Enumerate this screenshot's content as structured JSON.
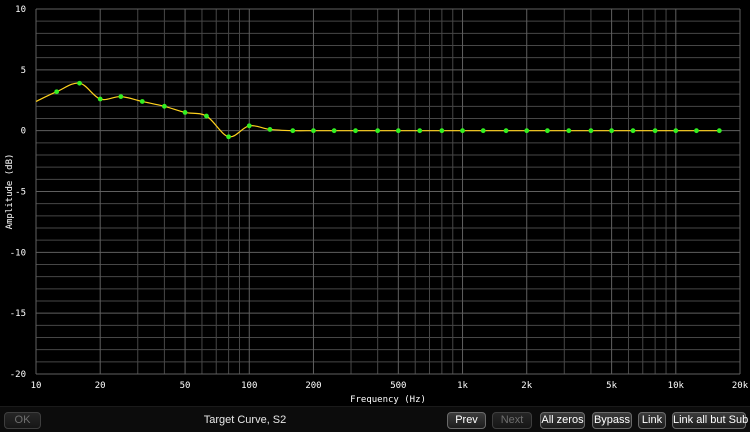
{
  "chart_data": {
    "type": "line",
    "xlabel": "Frequency (Hz)",
    "ylabel": "Amplitude (dB)",
    "xscale": "log",
    "xlim": [
      10,
      20000
    ],
    "ylim": [
      -20,
      10
    ],
    "grid": true,
    "x_ticks": [
      {
        "value": 10,
        "label": "10"
      },
      {
        "value": 20,
        "label": "20"
      },
      {
        "value": 50,
        "label": "50"
      },
      {
        "value": 100,
        "label": "100"
      },
      {
        "value": 200,
        "label": "200"
      },
      {
        "value": 500,
        "label": "500"
      },
      {
        "value": 1000,
        "label": "1k"
      },
      {
        "value": 2000,
        "label": "2k"
      },
      {
        "value": 5000,
        "label": "5k"
      },
      {
        "value": 10000,
        "label": "10k"
      },
      {
        "value": 20000,
        "label": "20k"
      }
    ],
    "y_ticks": [
      {
        "value": 10,
        "label": "10"
      },
      {
        "value": 5,
        "label": "5"
      },
      {
        "value": 0,
        "label": "0"
      },
      {
        "value": -5,
        "label": "-5"
      },
      {
        "value": -10,
        "label": "-10"
      },
      {
        "value": -15,
        "label": "-15"
      },
      {
        "value": -20,
        "label": "-20"
      }
    ],
    "series": [
      {
        "x": [
          12.5,
          16,
          20,
          25,
          31.5,
          40,
          50,
          63,
          80,
          100,
          125,
          160,
          200,
          250,
          315,
          400,
          500,
          630,
          800,
          1000,
          1250,
          1600,
          2000,
          2500,
          3150,
          4000,
          5000,
          6300,
          8000,
          10000,
          12500,
          16000
        ],
        "y": [
          3.2,
          3.9,
          2.6,
          2.8,
          2.4,
          2.0,
          1.5,
          1.2,
          -0.5,
          0.4,
          0.1,
          0,
          0,
          0,
          0,
          0,
          0,
          0,
          0,
          0,
          0,
          0,
          0,
          0,
          0,
          0,
          0,
          0,
          0,
          0,
          0,
          0
        ]
      }
    ],
    "curve_start": {
      "x": 10,
      "y": 2.4
    },
    "colors": {
      "background": "#000000",
      "grid": "#5f5f5f",
      "grid_minor": "#474747",
      "line": "#ffd21e",
      "point": "#33ee22",
      "text": "#ffffff"
    }
  },
  "footer": {
    "ok_label": "OK",
    "curve_name": "Target Curve, S2",
    "prev_label": "Prev",
    "next_label": "Next",
    "all_zeros_label": "All zeros",
    "bypass_label": "Bypass",
    "link_label": "Link",
    "link_all_but_sub_label": "Link all but Sub"
  }
}
